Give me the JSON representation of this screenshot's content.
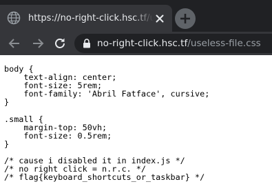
{
  "tab": {
    "title": "https://no-right-click.hsc.tf/useless-file.css",
    "favicon": "globe-icon",
    "close_icon": "close-icon"
  },
  "new_tab_icon": "plus-icon",
  "toolbar": {
    "back_icon": "arrow-left-icon",
    "forward_icon": "arrow-right-icon",
    "reload_icon": "reload-icon",
    "lock_icon": "lock-icon",
    "url_host": "no-right-click.hsc.tf",
    "url_path": "/useless-file.css"
  },
  "code_lines": [
    "body {",
    "    text-align: center;",
    "    font-size: 5rem;",
    "    font-family: 'Abril Fatface', cursive;",
    "}",
    "",
    ".small {",
    "    margin-top: 50vh;",
    "    font-size: 0.5rem;",
    "}",
    "",
    "/* cause i disabled it in index.js */",
    "/* no right click = n.r.c. */",
    "/* flag{keyboard_shortcuts_or_taskbar} */"
  ],
  "colors": {
    "tabstrip_bg": "#202124",
    "active_tab_bg": "#35363a",
    "omnibox_bg": "#202124",
    "text_light": "#e8eaed",
    "text_dim": "#9aa0a6"
  }
}
